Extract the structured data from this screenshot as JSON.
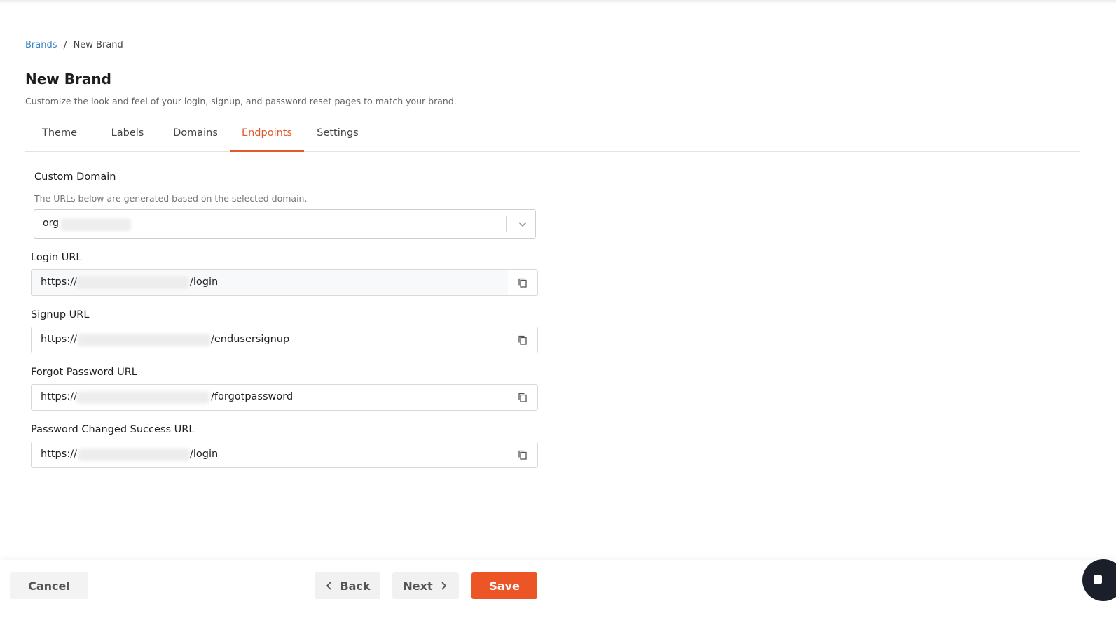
{
  "breadcrumb": {
    "parent": "Brands",
    "separator": "/",
    "current": "New Brand"
  },
  "page": {
    "title": "New Brand",
    "description": "Customize the look and feel of your login, signup, and password reset pages to match your brand."
  },
  "tabs": [
    {
      "label": "Theme",
      "active": false
    },
    {
      "label": "Labels",
      "active": false
    },
    {
      "label": "Domains",
      "active": false
    },
    {
      "label": "Endpoints",
      "active": true
    },
    {
      "label": "Settings",
      "active": false
    }
  ],
  "custom_domain": {
    "label": "Custom Domain",
    "help": "The URLs below are generated based on the selected domain.",
    "selected_value": "org"
  },
  "endpoints": {
    "login": {
      "label": "Login URL",
      "prefix": "https://",
      "suffix": "/login"
    },
    "signup": {
      "label": "Signup URL",
      "prefix": "https://",
      "suffix": "/endusersignup"
    },
    "forgot": {
      "label": "Forgot Password URL",
      "prefix": "https://",
      "suffix": "/forgotpassword"
    },
    "changed": {
      "label": "Password Changed Success URL",
      "prefix": "https://",
      "suffix": "/login"
    }
  },
  "footer": {
    "cancel": "Cancel",
    "back": "Back",
    "next": "Next",
    "save": "Save"
  },
  "colors": {
    "accent": "#e05a2b",
    "save_button": "#ec5526",
    "link": "#3b82c4"
  }
}
